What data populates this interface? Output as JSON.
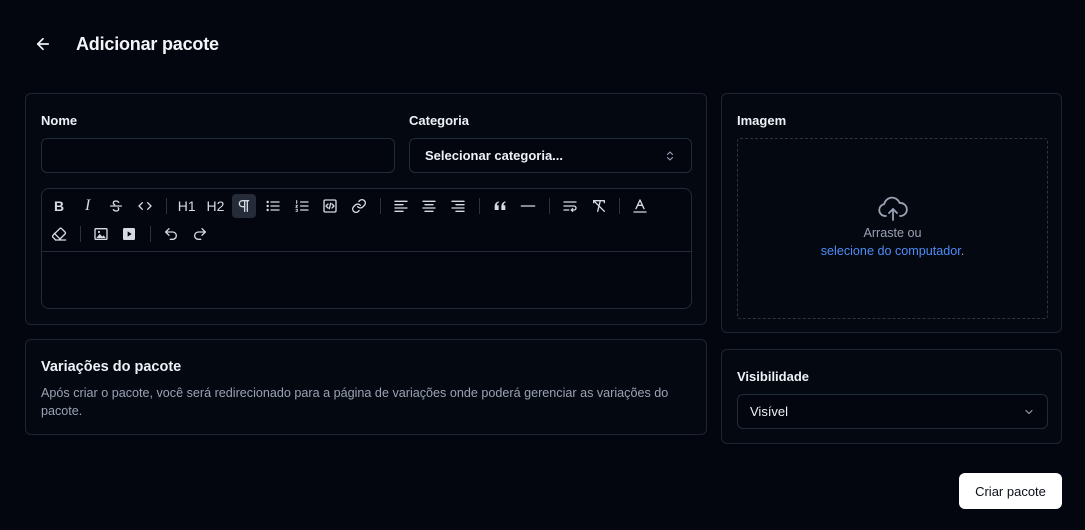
{
  "header": {
    "title": "Adicionar pacote"
  },
  "form": {
    "name_label": "Nome",
    "name_value": "",
    "category_label": "Categoria",
    "category_value": "Selecionar categoria..."
  },
  "toolbar": {
    "h1": "H1",
    "h2": "H2",
    "bold": "B",
    "italic": "I"
  },
  "variations": {
    "title": "Variações do pacote",
    "description": "Após criar o pacote, você será redirecionado para a página de variações onde poderá gerenciar as variações do pacote."
  },
  "image": {
    "label": "Imagem",
    "drop_text": "Arraste ou",
    "drop_link": "selecione do computador",
    "drop_suffix": "."
  },
  "visibility": {
    "label": "Visibilidade",
    "value": "Visível"
  },
  "actions": {
    "create_label": "Criar pacote"
  },
  "colors": {
    "accent_link": "#4f8cf6",
    "background": "#03060f",
    "border": "#1e2433"
  }
}
